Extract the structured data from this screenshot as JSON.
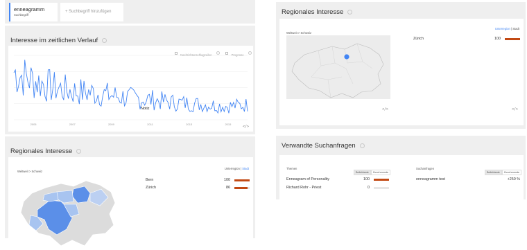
{
  "search": {
    "term": "enneagramm",
    "term_type": "Suchbegriff",
    "add_placeholder": "+ Suchbegriff hinzufügen"
  },
  "timeline": {
    "title": "Interesse im zeitlichen Verlauf",
    "news_label": "Nachrichtenschlagzeilen",
    "forecast_label": "Prognose",
    "annotation": "Notiz",
    "x_ticks": [
      "2005",
      "2007",
      "2009",
      "2011",
      "2013",
      "2015"
    ],
    "line_color": "#4285f4"
  },
  "regional_left": {
    "title": "Regionales Interesse",
    "breadcrumb": "Weltweit > Schweiz",
    "toggle_subregion": "Unterregion",
    "toggle_city": "Stadt",
    "rows": [
      {
        "name": "Bern",
        "value": "100",
        "pct": 100
      },
      {
        "name": "Zürich",
        "value": "86",
        "pct": 86
      }
    ]
  },
  "regional_right": {
    "title": "Regionales Interesse",
    "breadcrumb": "Weltweit > Schweiz",
    "toggle_subregion": "Unterregion",
    "toggle_city": "Stadt",
    "rows": [
      {
        "name": "Zürich",
        "value": "100",
        "pct": 100
      }
    ]
  },
  "related": {
    "title": "Verwandte Suchanfragen",
    "topics_header": "Themen",
    "queries_header": "Suchanfragen",
    "top_label": "Beliebteste",
    "rising_label": "Zunehmende",
    "topics": [
      {
        "name": "Enneagram of Personality",
        "value": "100",
        "pct": 100
      },
      {
        "name": "Richard Rohr - Priest",
        "value": "0",
        "pct": 0
      }
    ],
    "queries": [
      {
        "name": "enneagramm test",
        "value": "+250 %"
      }
    ]
  },
  "icons": {
    "embed": "embed-code-icon",
    "help": "help-circle-icon",
    "checkbox": "checkbox-icon"
  },
  "colors": {
    "bar": "#c24914",
    "map_highlight": "#5b8fe8",
    "map_light": "#a8c4f0",
    "map_base": "#dcdcdc",
    "dot": "#4285f4"
  },
  "chart_data": {
    "type": "line",
    "x": [
      "2004",
      "2005",
      "2006",
      "2007",
      "2008",
      "2009",
      "2010",
      "2011",
      "2012",
      "2013",
      "2014",
      "2015",
      "2016"
    ],
    "series": [
      {
        "values": [
          70,
          58,
          48,
          42,
          40,
          36,
          32,
          30,
          26,
          24,
          22,
          20,
          22
        ]
      }
    ],
    "ylim": [
      0,
      100
    ],
    "x_ticks": [
      "2005",
      "2007",
      "2009",
      "2011",
      "2013",
      "2015"
    ]
  }
}
